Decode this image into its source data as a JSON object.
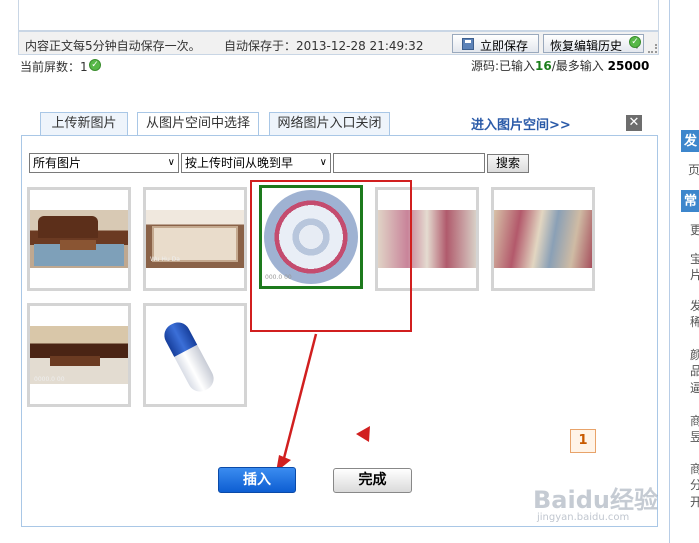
{
  "status_bar": {
    "autosave_note": "内容正文每5分钟自动保存一次。",
    "autosave_time": "自动保存于：2013-12-28 21:49:32",
    "save_now_label": "立即保存",
    "restore_history_label": "恢复编辑历史"
  },
  "screen_count": {
    "label": "当前屏数：",
    "value": "1"
  },
  "source_count": {
    "prefix": "源码:已输入",
    "entered": "16",
    "sep": "/最多输入",
    "max": "25000"
  },
  "dialog": {
    "tabs": [
      {
        "label": "上传新图片",
        "active": false
      },
      {
        "label": "从图片空间中选择",
        "active": true
      },
      {
        "label": "网络图片入口关闭",
        "active": false
      }
    ],
    "enter_space_link": "进入图片空间>>",
    "close_icon": "close-icon",
    "filter": {
      "category_selected": "所有图片",
      "sort_selected": "按上传时间从晚到早",
      "search_value": "",
      "search_button": "搜索"
    },
    "thumbnails": [
      {
        "name": "sofa-carpet-living-room",
        "selected": false
      },
      {
        "name": "beige-floral-carpet",
        "selected": false
      },
      {
        "name": "round-floral-carpet",
        "selected": true
      },
      {
        "name": "carpet-closeup-red-floral",
        "selected": false
      },
      {
        "name": "carpet-closeup-pattern",
        "selected": false
      },
      {
        "name": "sofa-carpet-white",
        "selected": false
      },
      {
        "name": "blue-adhesive-tube",
        "selected": false
      }
    ],
    "page_current": "1",
    "insert_button": "插入",
    "done_button": "完成"
  },
  "right_sidebar": {
    "header_char": "发",
    "header2_char": "常",
    "chars": [
      "页",
      "更",
      "宝",
      "片",
      "发",
      "稀",
      "颜",
      "品",
      "逼",
      "商",
      "昱",
      "商",
      "分",
      "开"
    ]
  },
  "watermark": {
    "logo_text": "Baidu经验",
    "url": "jingyan.baidu.com"
  },
  "colors": {
    "dialog_border": "#a9c7e6",
    "selection_green": "#1d7a1d",
    "annotation_red": "#d11f1f",
    "insert_blue": "#0d5ed2"
  }
}
